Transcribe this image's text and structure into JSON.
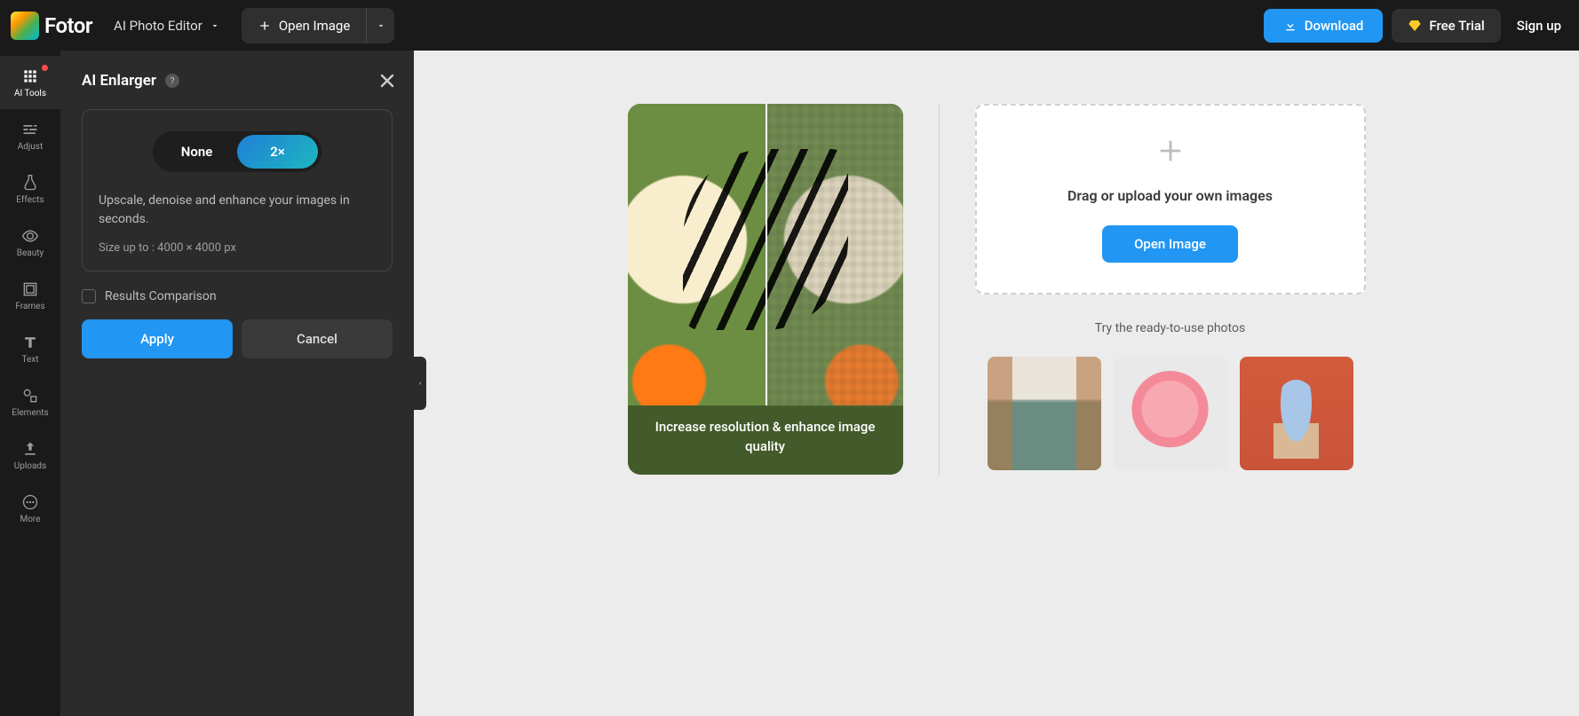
{
  "header": {
    "brand": "Fotor",
    "mode": "AI Photo Editor",
    "open_image": "Open Image",
    "download": "Download",
    "free_trial": "Free Trial",
    "sign_up": "Sign up"
  },
  "rail": {
    "ai_tools": "AI Tools",
    "adjust": "Adjust",
    "effects": "Effects",
    "beauty": "Beauty",
    "frames": "Frames",
    "text": "Text",
    "elements": "Elements",
    "uploads": "Uploads",
    "more": "More"
  },
  "panel": {
    "title": "AI Enlarger",
    "seg_none": "None",
    "seg_2x": "2×",
    "description": "Upscale, denoise and enhance your images in seconds.",
    "size_hint": "Size up to : 4000 × 4000 px",
    "results_comparison": "Results Comparison",
    "apply": "Apply",
    "cancel": "Cancel"
  },
  "canvas": {
    "demo_caption": "Increase resolution & enhance image quality",
    "drop_text": "Drag or upload your own images",
    "open_image": "Open Image",
    "try_text": "Try the ready-to-use photos"
  }
}
